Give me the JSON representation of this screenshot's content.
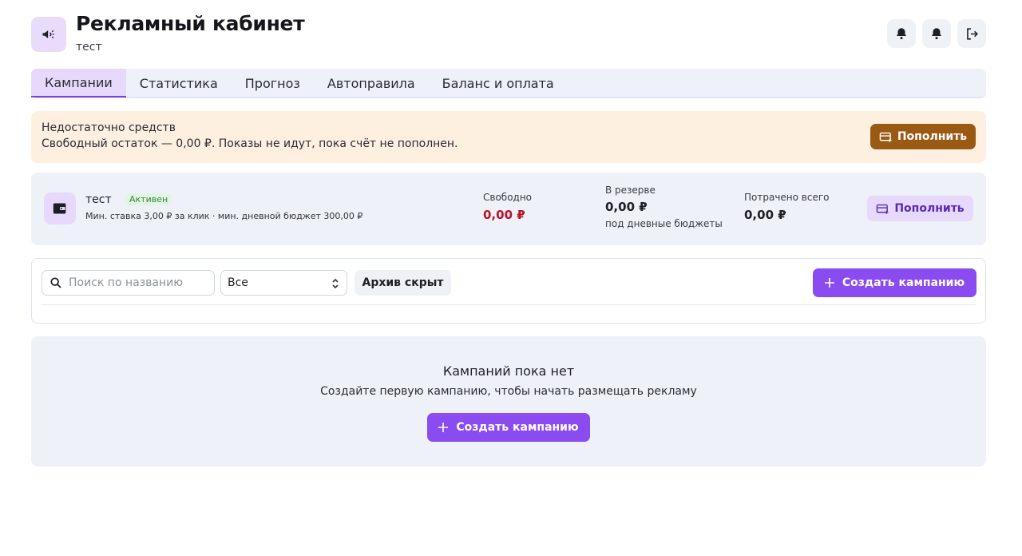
{
  "header": {
    "title": "Рекламный кабинет",
    "subtitle": "тест",
    "app_icon": "megaphone-icon",
    "buttons": [
      {
        "icon": "bell-icon"
      },
      {
        "icon": "bell-icon"
      },
      {
        "icon": "logout-icon"
      }
    ]
  },
  "tabs": [
    {
      "label": "Кампании",
      "active": true
    },
    {
      "label": "Статистика",
      "active": false
    },
    {
      "label": "Прогноз",
      "active": false
    },
    {
      "label": "Автоправила",
      "active": false
    },
    {
      "label": "Баланс и оплата",
      "active": false
    }
  ],
  "alert": {
    "title": "Недостаточно средств",
    "text": "Свободный остаток — 0,00 ₽. Показы не идут, пока счёт не пополнен.",
    "button_label": "Пополнить",
    "button_icon": "card-plus-icon"
  },
  "account": {
    "icon": "wallet-icon",
    "name": "тест",
    "status": "Активен",
    "description": "Мин. ставка 3,00 ₽ за клик · мин. дневной бюджет 300,00 ₽",
    "free_label": "Свободно",
    "free_value": "0,00 ₽",
    "reserve_label": "В резерве",
    "reserve_value": "0,00 ₽",
    "reserve_note": "под дневные бюджеты",
    "spent_label": "Потрачено всего",
    "spent_value": "0,00 ₽",
    "button_label": "Пополнить"
  },
  "toolbar": {
    "search_placeholder": "Поиск по названию",
    "search_value": "",
    "filter_value": "Все",
    "archive_label": "Архив скрыт",
    "create_label": "Создать кампанию"
  },
  "empty_state": {
    "title": "Кампаний пока нет",
    "text": "Создайте первую кампанию, чтобы начать размещать рекламу",
    "button_label": "Создать кампанию"
  },
  "colors": {
    "accent": "#8a4bf0",
    "accent_light": "#e6d9fb",
    "warning_bg": "#fdf0e1",
    "warning_button": "#9a5a14",
    "danger": "#b8152a",
    "success": "#2e8b3a"
  }
}
